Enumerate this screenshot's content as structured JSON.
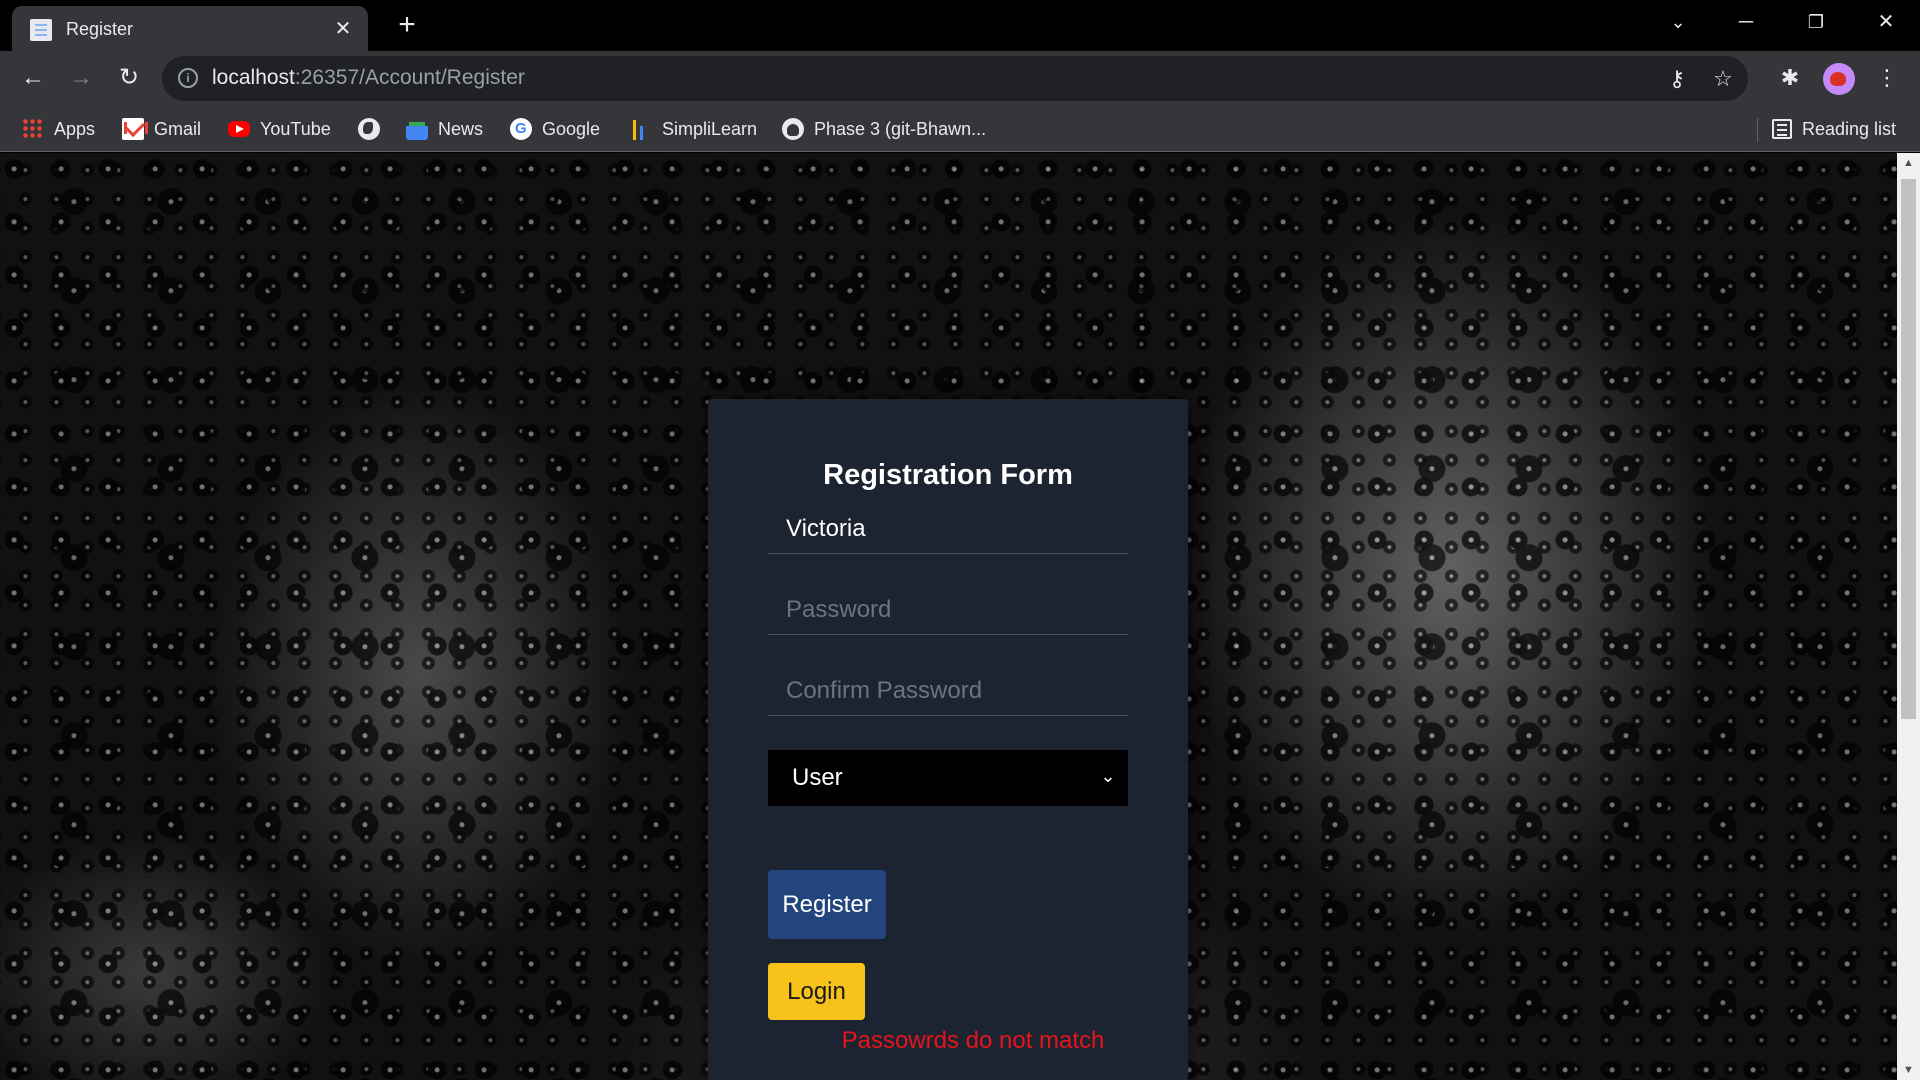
{
  "browser": {
    "tab_title": "Register",
    "url_host": "localhost",
    "url_rest": ":26357/Account/Register",
    "bookmarks": [
      {
        "label": "Apps",
        "icon": "apps-icon"
      },
      {
        "label": "Gmail",
        "icon": "gmail-icon"
      },
      {
        "label": "YouTube",
        "icon": "youtube-icon"
      },
      {
        "label": "",
        "icon": "globe-icon"
      },
      {
        "label": "News",
        "icon": "news-icon"
      },
      {
        "label": "Google",
        "icon": "google-icon"
      },
      {
        "label": "SimpliLearn",
        "icon": "simplilearn-icon"
      },
      {
        "label": "Phase 3 (git-Bhawn...",
        "icon": "github-icon"
      }
    ],
    "reading_list": "Reading list"
  },
  "form": {
    "title": "Registration Form",
    "username_value": "Victoria",
    "password_placeholder": "Password",
    "confirm_placeholder": "Confirm Password",
    "role_selected": "User",
    "register_label": "Register",
    "login_label": "Login",
    "error_message": "Passowrds do not match"
  },
  "colors": {
    "card_bg": "#1c2331",
    "register_btn": "#23457e",
    "login_btn": "#f7c31a",
    "error_text": "#e5151c"
  }
}
